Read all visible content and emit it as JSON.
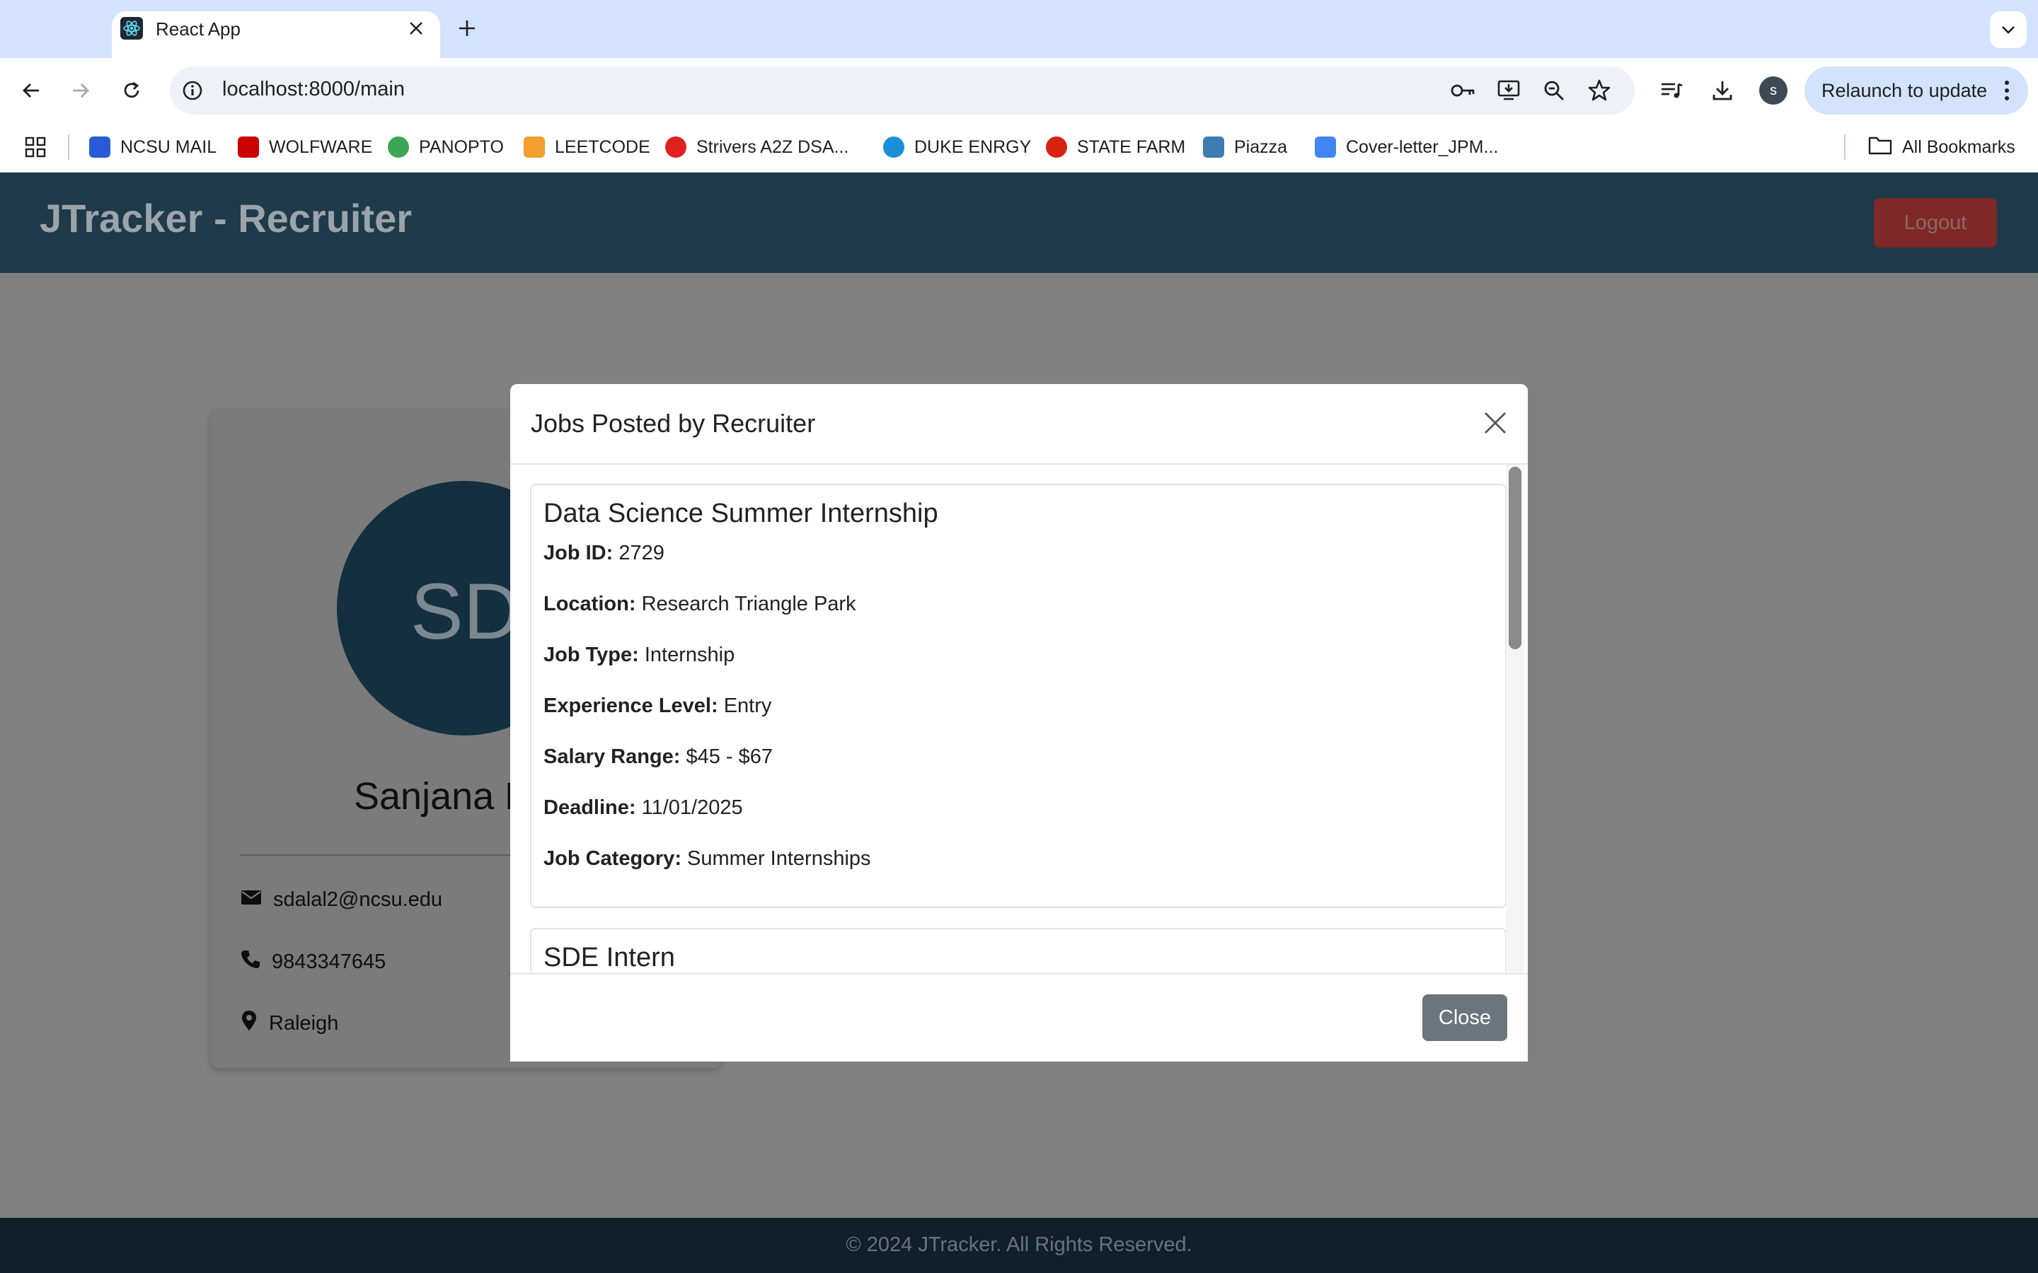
{
  "browser": {
    "tab_title": "React App",
    "url": "localhost:8000/main",
    "relaunch_label": "Relaunch to update",
    "profile_initial": "s",
    "bookmarks": [
      {
        "label": "NCSU MAIL",
        "color": "#2a5bd7"
      },
      {
        "label": "WOLFWARE",
        "color": "#cc0000"
      },
      {
        "label": "PANOPTO",
        "color": "#3aa655"
      },
      {
        "label": "LEETCODE",
        "color": "#f0a030"
      },
      {
        "label": "Strivers A2Z DSA...",
        "color": "#e02020"
      },
      {
        "label": "DUKE ENRGY",
        "color": "#1a8fd8"
      },
      {
        "label": "STATE FARM",
        "color": "#d62311"
      },
      {
        "label": "Piazza",
        "color": "#3e7cb1"
      },
      {
        "label": "Cover-letter_JPM...",
        "color": "#4285f4"
      }
    ],
    "all_bookmarks_label": "All Bookmarks"
  },
  "app": {
    "title": "JTracker - Recruiter",
    "logout_label": "Logout",
    "footer": "© 2024 JTracker. All Rights Reserved."
  },
  "profile": {
    "initials": "SD",
    "name": "Sanjana D",
    "email": "sdalal2@ncsu.edu",
    "phone": "9843347645",
    "location": "Raleigh"
  },
  "modal": {
    "title": "Jobs Posted by Recruiter",
    "close_label": "Close",
    "jobs": [
      {
        "title": "Data Science Summer Internship",
        "fields": [
          {
            "label": "Job ID:",
            "value": "2729"
          },
          {
            "label": "Location:",
            "value": "Research Triangle Park"
          },
          {
            "label": "Job Type:",
            "value": "Internship"
          },
          {
            "label": "Experience Level:",
            "value": "Entry"
          },
          {
            "label": "Salary Range:",
            "value": "$45 - $67"
          },
          {
            "label": "Deadline:",
            "value": "11/01/2025"
          },
          {
            "label": "Job Category:",
            "value": "Summer Internships"
          }
        ]
      },
      {
        "title": "SDE Intern"
      }
    ]
  }
}
